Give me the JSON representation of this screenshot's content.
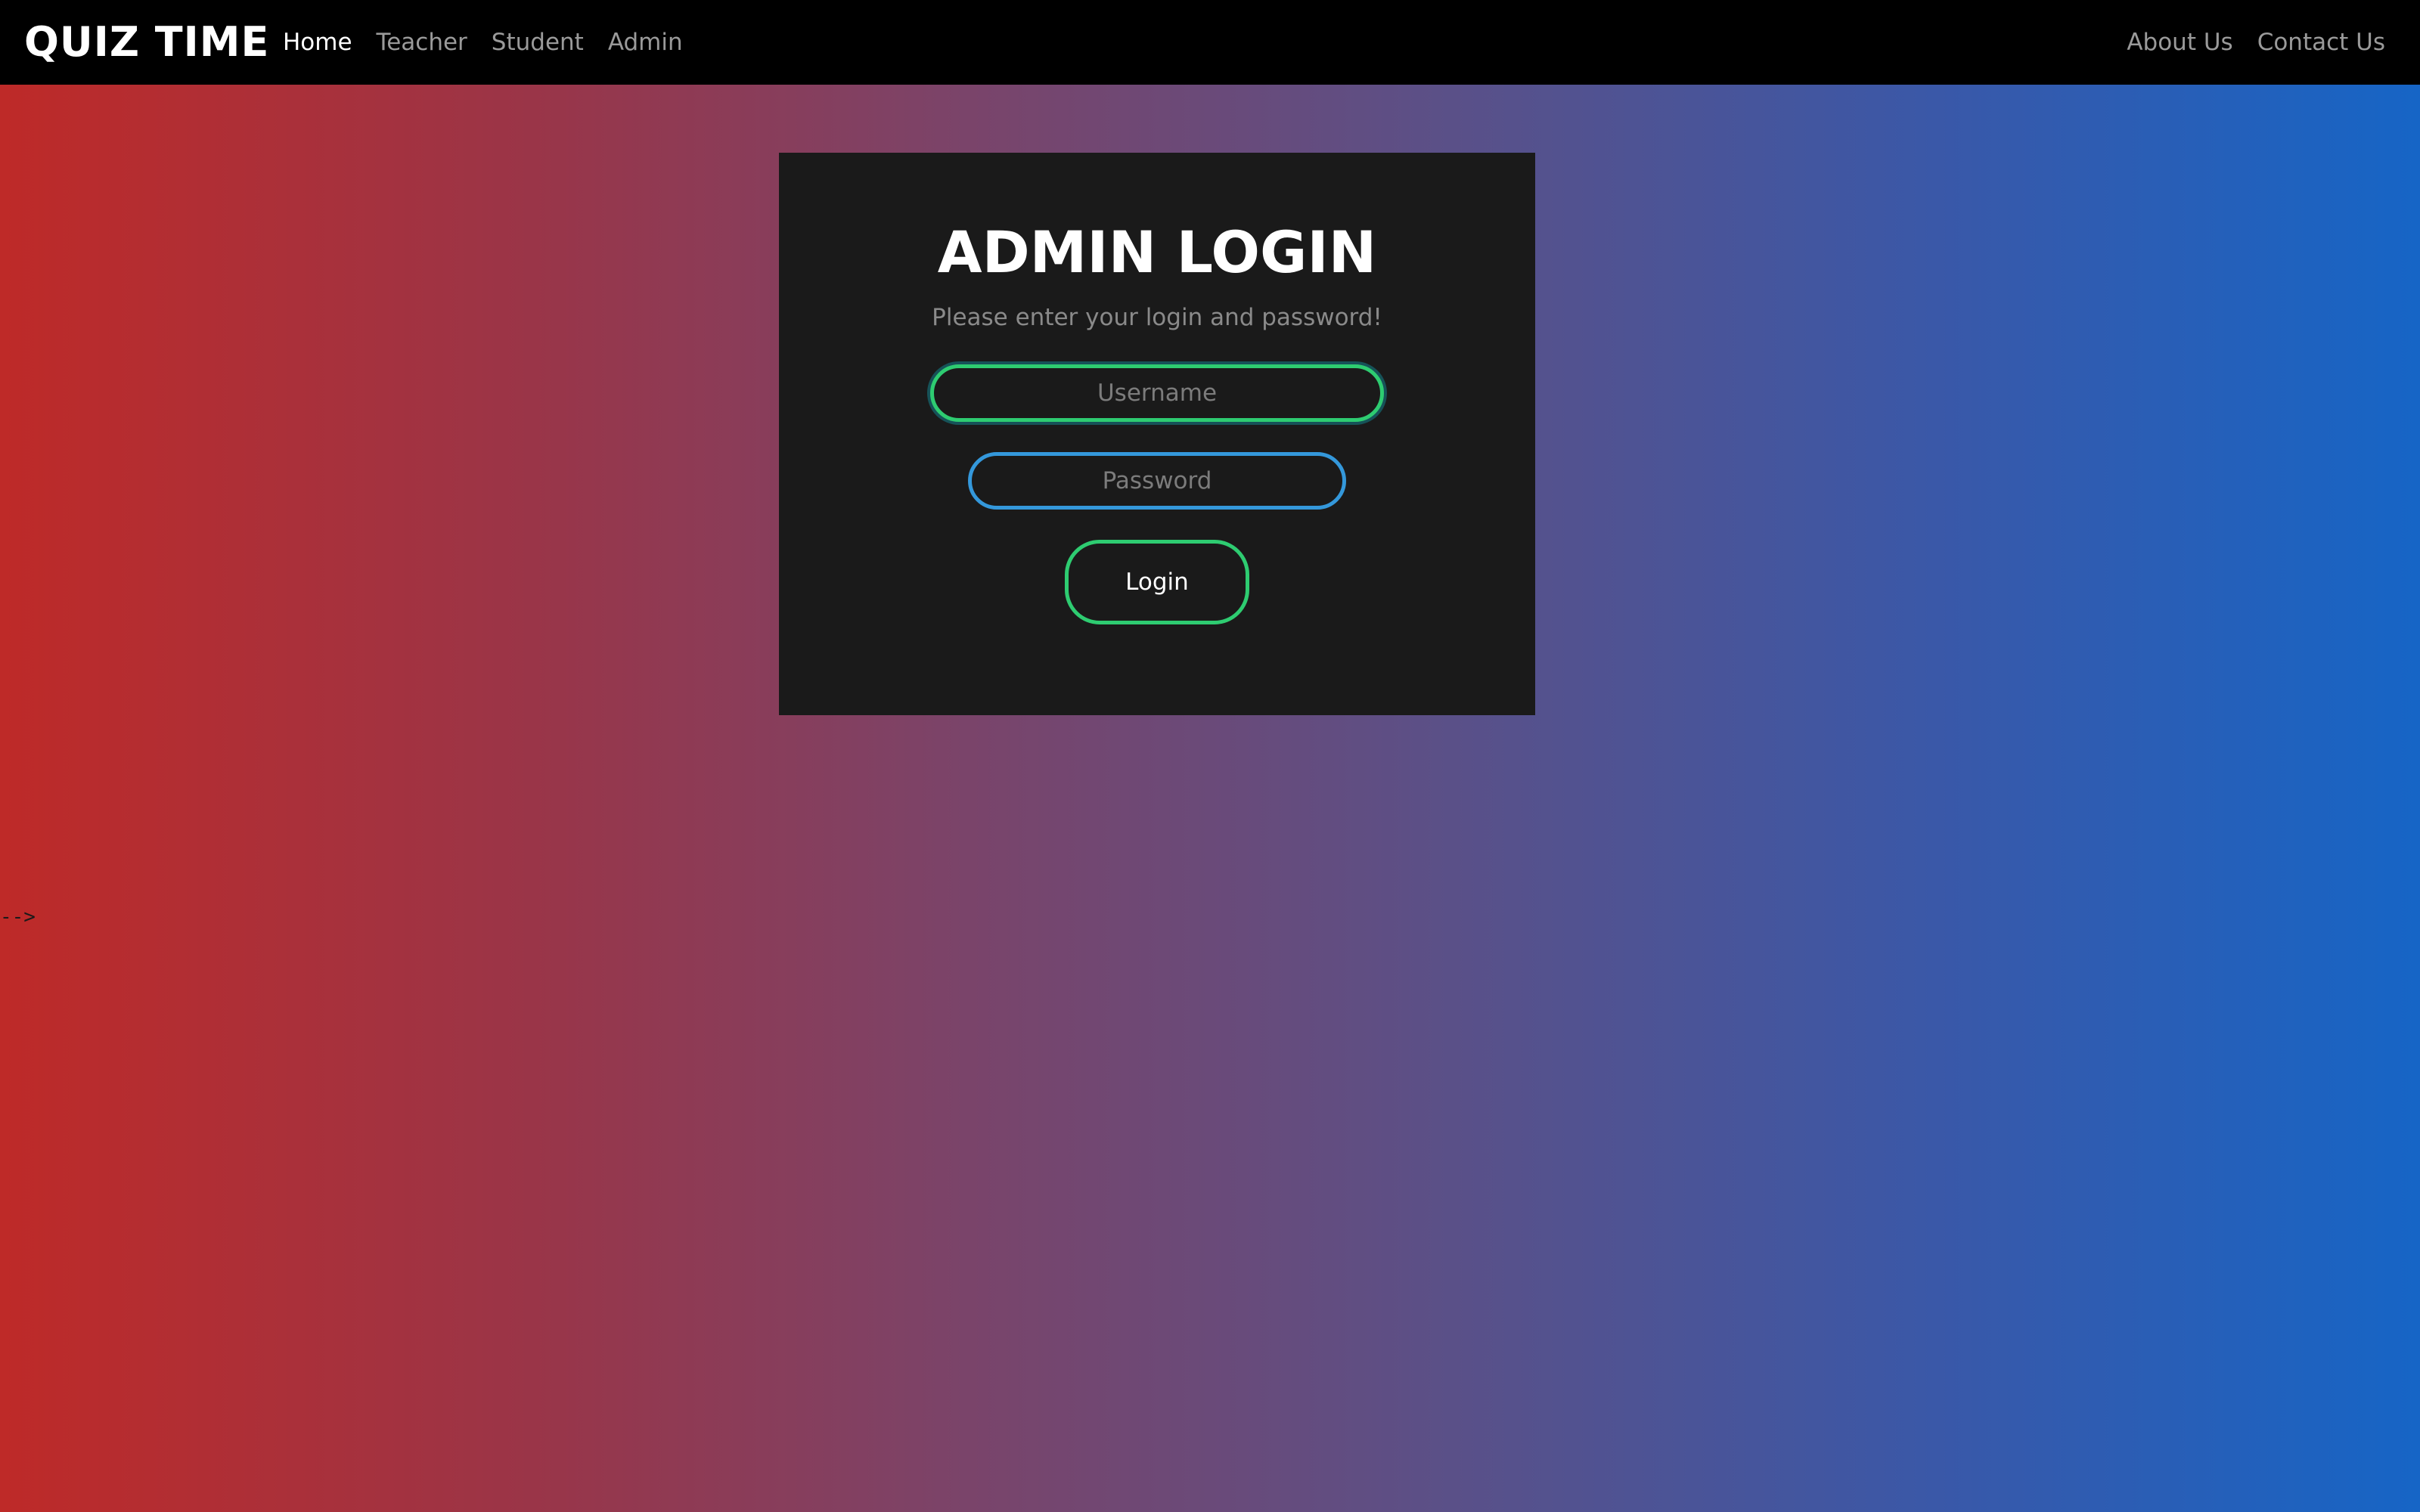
{
  "navbar": {
    "brand": "QUIZ TIME",
    "left_links": [
      {
        "label": "Home",
        "active": true
      },
      {
        "label": "Teacher",
        "active": false
      },
      {
        "label": "Student",
        "active": false
      },
      {
        "label": "Admin",
        "active": false
      }
    ],
    "right_links": [
      {
        "label": "About Us"
      },
      {
        "label": "Contact Us"
      }
    ]
  },
  "login": {
    "title": "ADMIN LOGIN",
    "subtitle": "Please enter your login and password!",
    "username_placeholder": "Username",
    "username_value": "",
    "password_placeholder": "Password",
    "password_value": "",
    "button_label": "Login"
  },
  "stray_text": "-->",
  "colors": {
    "navbar_bg": "#000000",
    "card_bg": "#1a1a1a",
    "gradient_left": "#be2a28",
    "gradient_right": "#1665c6",
    "accent_green": "#2ecc71",
    "accent_blue": "#3498db"
  }
}
